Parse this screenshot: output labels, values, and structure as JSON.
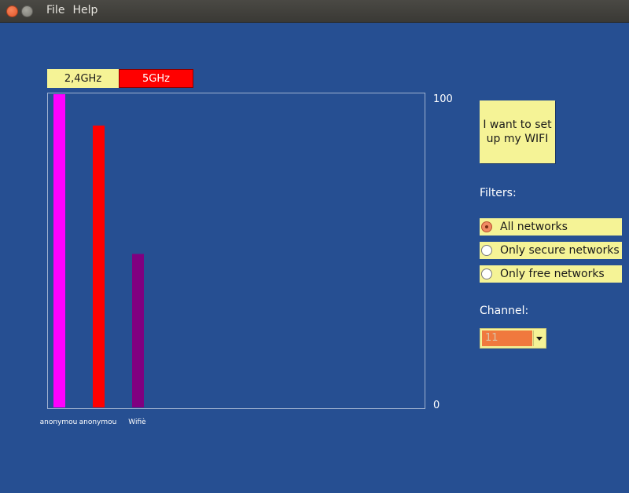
{
  "window": {
    "close_icon": "close-icon",
    "minimize_icon": "minimize-icon"
  },
  "menu": {
    "items": [
      "File",
      "Help"
    ]
  },
  "bands": {
    "tab_24": "2,4GHz",
    "tab_5": "5GHz",
    "tab_24_color": "#f5f396",
    "tab_5_color": "#ff0000"
  },
  "chart_data": {
    "type": "bar",
    "categories": [
      "anonymou",
      "anonymou",
      "Wifiè"
    ],
    "values": [
      100,
      90,
      49
    ],
    "colors": [
      "#ff00ff",
      "#ff0000",
      "#800080"
    ],
    "ylim": [
      0,
      100
    ],
    "y_top_label": "100",
    "y_bottom_label": "0",
    "grid": false
  },
  "panel": {
    "setup_button": "I want to set up my WIFI",
    "filters_label": "Filters:",
    "filters": [
      {
        "label": "All networks",
        "checked": true
      },
      {
        "label": "Only secure networks",
        "checked": false
      },
      {
        "label": "Only free networks",
        "checked": false
      }
    ],
    "channel_label": "Channel:",
    "channel_value": "11"
  },
  "colors": {
    "background": "#264f92",
    "accent_yellow": "#f5f396",
    "channel_orange": "#f0793e"
  }
}
